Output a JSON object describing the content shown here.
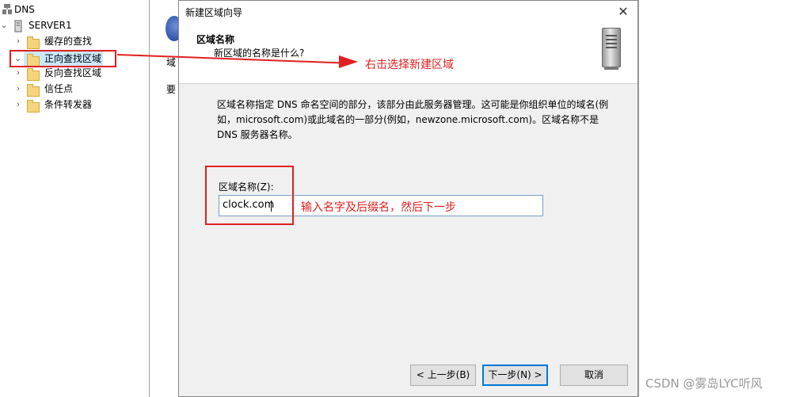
{
  "tree": {
    "root": "DNS",
    "server": "SERVER1",
    "items": [
      {
        "label": "缓存的查找"
      },
      {
        "label": "正向查找区域"
      },
      {
        "label": "反向查找区域"
      },
      {
        "label": "信任点"
      },
      {
        "label": "条件转发器"
      }
    ]
  },
  "background": {
    "text1": "域",
    "text2": "要"
  },
  "dialog": {
    "title": "新建区域向导",
    "close": "✕",
    "header_title": "区域名称",
    "header_subtitle": "新区域的名称是什么?",
    "description": "区域名称指定 DNS 命名空间的部分，该部分由此服务器管理。这可能是你组织单位的域名(例如，microsoft.com)或此域名的一部分(例如，newzone.microsoft.com)。区域名称不是 DNS 服务器名称。",
    "zone_label": "区域名称(Z):",
    "zone_value": "clock.com",
    "back_button": "< 上一步(B)",
    "next_button": "下一步(N) >",
    "cancel_button": "取消"
  },
  "annotations": {
    "arrow_note": "右击选择新建区域",
    "input_note": "输入名字及后缀名，然后下一步",
    "accent": "#e02020"
  },
  "watermark": "CSDN @雾岛LYC听风"
}
